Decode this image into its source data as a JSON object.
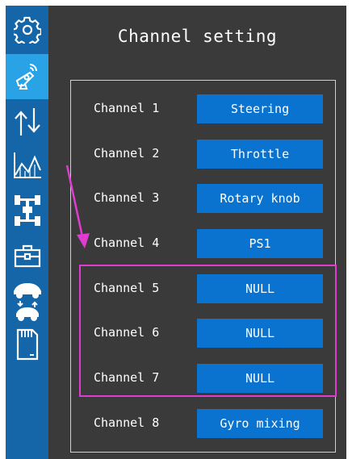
{
  "title": "Channel setting",
  "sidebar": {
    "items": [
      {
        "icon": "gear-icon",
        "active": false
      },
      {
        "icon": "transmitter-icon",
        "active": true
      },
      {
        "icon": "reverse-arrows-icon",
        "active": false
      },
      {
        "icon": "curve-chart-icon",
        "active": false
      },
      {
        "icon": "chassis-icon",
        "active": false
      },
      {
        "icon": "toolbox-icon",
        "active": false
      },
      {
        "icon": "model-swap-icon",
        "active": false
      },
      {
        "icon": "sd-card-icon",
        "active": false
      }
    ]
  },
  "channels": [
    {
      "label": "Channel 1",
      "value": "Steering"
    },
    {
      "label": "Channel 2",
      "value": "Throttle"
    },
    {
      "label": "Channel 3",
      "value": "Rotary knob"
    },
    {
      "label": "Channel 4",
      "value": "PS1"
    },
    {
      "label": "Channel 5",
      "value": "NULL"
    },
    {
      "label": "Channel 6",
      "value": "NULL"
    },
    {
      "label": "Channel 7",
      "value": "NULL"
    },
    {
      "label": "Channel 8",
      "value": "Gyro mixing"
    }
  ],
  "colors": {
    "background": "#3a3a3a",
    "sidebar": "#1466a8",
    "sidebar_active": "#2aa3e6",
    "value_box": "#0a72cf",
    "highlight": "#e03ccf"
  }
}
